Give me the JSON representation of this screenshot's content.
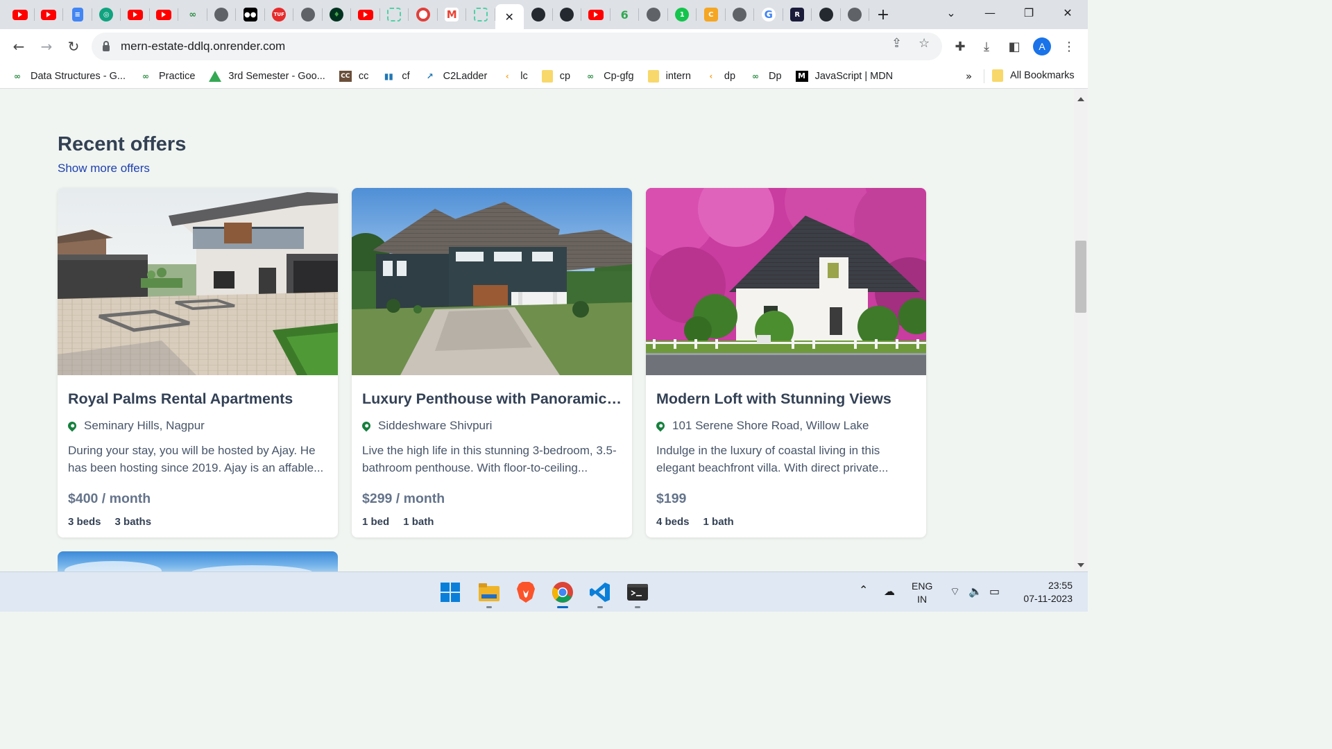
{
  "browser": {
    "tabs": [
      {
        "icon": "youtube-icon"
      },
      {
        "icon": "youtube-icon"
      },
      {
        "icon": "google-docs-icon"
      },
      {
        "icon": "chatgpt-icon"
      },
      {
        "icon": "youtube-icon"
      },
      {
        "icon": "youtube-icon"
      },
      {
        "icon": "geeksforgeeks-icon"
      },
      {
        "icon": "globe-icon"
      },
      {
        "icon": "medium-icon"
      },
      {
        "icon": "takeuforward-icon"
      },
      {
        "icon": "globe-icon"
      },
      {
        "icon": "mongodb-icon"
      },
      {
        "icon": "youtube-icon"
      },
      {
        "icon": "screenshot-icon"
      },
      {
        "icon": "record-icon"
      },
      {
        "icon": "gmail-icon"
      },
      {
        "icon": "screenshot-icon"
      },
      {
        "icon": "close-icon",
        "active": true
      },
      {
        "icon": "github-icon"
      },
      {
        "icon": "github-icon"
      },
      {
        "icon": "youtube-icon"
      },
      {
        "icon": "leaf-icon"
      },
      {
        "icon": "globe-icon"
      },
      {
        "icon": "one-icon"
      },
      {
        "icon": "codechef-icon"
      },
      {
        "icon": "globe-icon"
      },
      {
        "icon": "google-icon"
      },
      {
        "icon": "replit-icon"
      },
      {
        "icon": "github-icon"
      },
      {
        "icon": "globe-icon"
      }
    ],
    "url": "mern-estate-ddlq.onrender.com",
    "profile_initial": "A",
    "bookmarks": [
      {
        "label": "Data Structures - G...",
        "icon": "geeksforgeeks-icon"
      },
      {
        "label": "Practice",
        "icon": "geeksforgeeks-icon"
      },
      {
        "label": "3rd Semester - Goo...",
        "icon": "google-drive-icon"
      },
      {
        "label": "cc",
        "icon": "codechef-icon"
      },
      {
        "label": "cf",
        "icon": "codeforces-icon"
      },
      {
        "label": "C2Ladder",
        "icon": "chart-icon"
      },
      {
        "label": "lc",
        "icon": "leetcode-icon"
      },
      {
        "label": "cp",
        "icon": "folder-icon"
      },
      {
        "label": "Cp-gfg",
        "icon": "geeksforgeeks-icon"
      },
      {
        "label": "intern",
        "icon": "folder-icon"
      },
      {
        "label": "dp",
        "icon": "leetcode-icon"
      },
      {
        "label": "Dp",
        "icon": "geeksforgeeks-icon"
      },
      {
        "label": "JavaScript | MDN",
        "icon": "mdn-icon"
      }
    ],
    "bookmarks_more": "»",
    "all_bookmarks": "All Bookmarks"
  },
  "page": {
    "section_title": "Recent offers",
    "show_more": "Show more offers",
    "listings": [
      {
        "title": "Royal Palms Rental Apartments",
        "address": "Seminary Hills, Nagpur",
        "description": "During your stay, you will be hosted by Ajay. He has been hosting since 2019. Ajay is an affable...",
        "price": "$400 / month",
        "beds": "3 beds",
        "baths": "3 baths"
      },
      {
        "title": "Luxury Penthouse with Panoramic ...",
        "address": "Siddeshware Shivpuri",
        "description": "Live the high life in this stunning 3-bedroom, 3.5-bathroom penthouse. With floor-to-ceiling...",
        "price": "$299 / month",
        "beds": "1 bed",
        "baths": "1 bath"
      },
      {
        "title": "Modern Loft with Stunning Views",
        "address": "101 Serene Shore Road, Willow Lake",
        "description": "Indulge in the luxury of coastal living in this elegant beachfront villa. With direct private...",
        "price": "$199",
        "beds": "4 beds",
        "baths": "1 bath"
      }
    ]
  },
  "taskbar": {
    "apps": [
      "windows-start-icon",
      "file-explorer-icon",
      "brave-icon",
      "chrome-icon",
      "vscode-icon",
      "terminal-icon"
    ],
    "lang_line1": "ENG",
    "lang_line2": "IN",
    "time": "23:55",
    "date": "07-11-2023"
  }
}
